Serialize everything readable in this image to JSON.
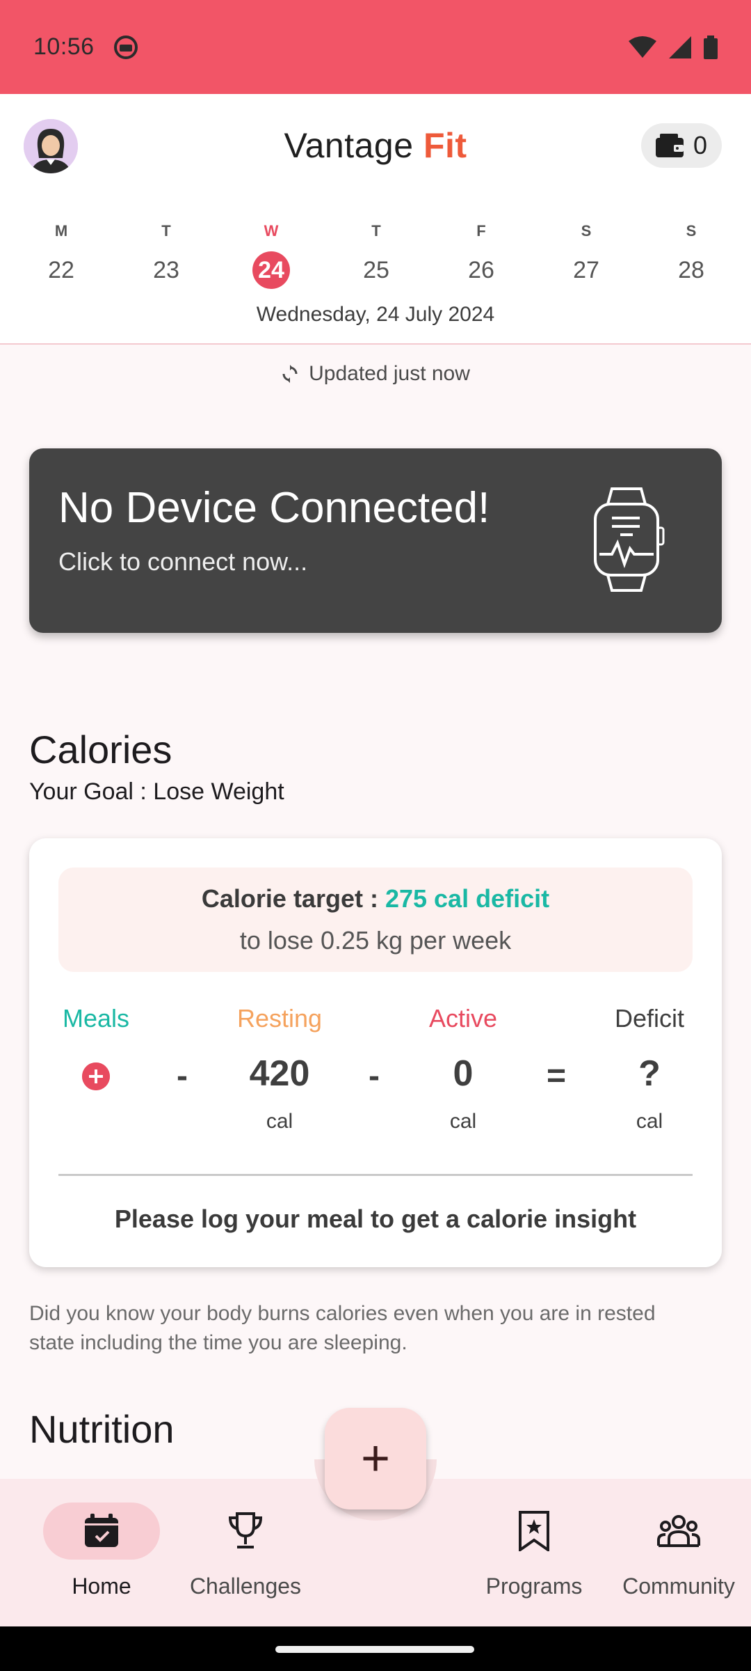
{
  "status_bar": {
    "time": "10:56"
  },
  "header": {
    "brand_main": "Vantage ",
    "brand_accent": "Fit",
    "wallet_count": "0"
  },
  "week": {
    "days": [
      {
        "dow": "M",
        "num": "22"
      },
      {
        "dow": "T",
        "num": "23"
      },
      {
        "dow": "W",
        "num": "24"
      },
      {
        "dow": "T",
        "num": "25"
      },
      {
        "dow": "F",
        "num": "26"
      },
      {
        "dow": "S",
        "num": "27"
      },
      {
        "dow": "S",
        "num": "28"
      }
    ],
    "selected_index": 2,
    "full_date": "Wednesday, 24 July 2024"
  },
  "sync": {
    "text": "Updated just now"
  },
  "device_card": {
    "title": "No Device Connected!",
    "subtitle": "Click to connect now..."
  },
  "calories": {
    "section_title": "Calories",
    "goal": "Your Goal : Lose Weight",
    "target_label": "Calorie target : ",
    "target_value": "275 cal deficit",
    "target_sub": "to lose 0.25 kg per week",
    "columns": {
      "meals": {
        "label": "Meals"
      },
      "resting": {
        "label": "Resting",
        "value": "420",
        "unit": "cal"
      },
      "active": {
        "label": "Active",
        "value": "0",
        "unit": "cal"
      },
      "deficit": {
        "label": "Deficit",
        "value": "?",
        "unit": "cal"
      }
    },
    "operators": {
      "minus": "-",
      "equals": "="
    },
    "insight": "Please log your meal to get a calorie insight"
  },
  "fact": "Did you know your body burns calories even when you are in rested state including the time you are sleeping.",
  "nutrition": {
    "section_title": "Nutrition"
  },
  "fab": {
    "label": "+"
  },
  "bottom_nav": {
    "items": [
      {
        "label": "Home",
        "icon": "calendar-icon"
      },
      {
        "label": "Challenges",
        "icon": "trophy-icon"
      },
      {
        "label": "Programs",
        "icon": "bookmark-star-icon"
      },
      {
        "label": "Community",
        "icon": "people-icon"
      }
    ]
  },
  "colors": {
    "status_bar": "#f25567",
    "accent_red": "#e84a5f",
    "brand_orange": "#ee5a3a",
    "meals": "#1ab8a4",
    "resting": "#f5a25d",
    "active": "#e84a5f"
  }
}
